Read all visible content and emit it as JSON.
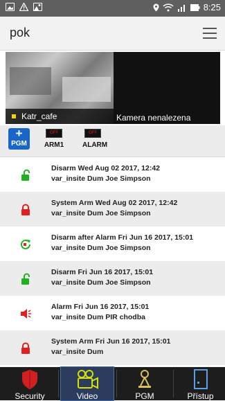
{
  "status_bar": {
    "time": "8:25"
  },
  "app": {
    "title": "pok"
  },
  "cameras": [
    {
      "name": "Katr_cafe",
      "overlay": ""
    },
    {
      "name": "Kamera nenalezena"
    }
  ],
  "outputs": {
    "pgm_button": {
      "line1": "+",
      "line2": "PGM"
    },
    "items": [
      {
        "state": "OFF",
        "name": "ARM1"
      },
      {
        "state": "OFF",
        "name": "ALARM"
      }
    ]
  },
  "events": [
    {
      "icon": "unlock-icon",
      "color": "#22b022",
      "line1": "Disarm Wed Aug 02 2017, 12:42",
      "line2": "var_insite Dum Joe Simpson"
    },
    {
      "icon": "lock-icon",
      "color": "#e02020",
      "line1": "System Arm Wed Aug 02 2017, 12:42",
      "line2": "var_insite Dum Joe Simpson"
    },
    {
      "icon": "disarm-after-alarm-icon",
      "color": "#22b022",
      "line1": "Disarm after Alarm Fri Jun 16 2017, 15:01",
      "line2": "var_insite Dum Joe Simpson"
    },
    {
      "icon": "unlock-icon",
      "color": "#22b022",
      "line1": "Disarm Fri Jun 16 2017, 15:01",
      "line2": "var_insite Dum Joe Simpson"
    },
    {
      "icon": "siren-icon",
      "color": "#e02020",
      "line1": "Alarm Fri Jun 16 2017, 15:01",
      "line2": "var_insite Dum PIR chodba"
    },
    {
      "icon": "lock-icon",
      "color": "#e02020",
      "line1": "System Arm Fri Jun 16 2017, 15:01",
      "line2": "var_insite Dum"
    }
  ],
  "nav": {
    "tabs": [
      {
        "label": "Security",
        "icon": "shield-icon",
        "color": "#d21f1f",
        "active": false
      },
      {
        "label": "Video",
        "icon": "video-camera-icon",
        "color": "#d8e000",
        "active": true
      },
      {
        "label": "PGM",
        "icon": "lamp-icon",
        "color": "#d8c060",
        "active": false
      },
      {
        "label": "Přístup",
        "icon": "door-icon",
        "color": "#5aa0e6",
        "active": false
      }
    ]
  }
}
